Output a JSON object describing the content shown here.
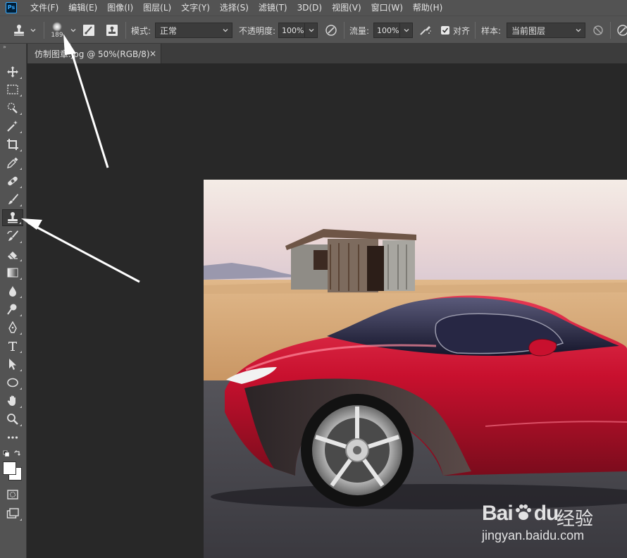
{
  "app": {
    "logo": "Ps",
    "menus": [
      "文件(F)",
      "编辑(E)",
      "图像(I)",
      "图层(L)",
      "文字(Y)",
      "选择(S)",
      "滤镜(T)",
      "3D(D)",
      "视图(V)",
      "窗口(W)",
      "帮助(H)"
    ]
  },
  "options": {
    "brush_size": "189",
    "mode_label": "模式:",
    "mode_value": "正常",
    "opacity_label": "不透明度:",
    "opacity_value": "100%",
    "flow_label": "流量:",
    "flow_value": "100%",
    "aligned_label": "对齐",
    "aligned_checked": true,
    "sample_label": "样本:",
    "sample_value": "当前图层"
  },
  "document": {
    "tab_title": "仿制图章.jpg @ 50%(RGB/8)",
    "close_glyph": "×"
  },
  "toolbox": {
    "collapse_glyph": "»",
    "active_tool": "clone-stamp-tool"
  },
  "watermark": {
    "logo_text": "Bai",
    "logo_suffix": "du",
    "chinese": "经验",
    "url": "jingyan.baidu.com"
  },
  "colors": {
    "accent": "#31a8ff",
    "panel": "#535353",
    "canvas": "#282828",
    "car_red": "#c8102e"
  }
}
